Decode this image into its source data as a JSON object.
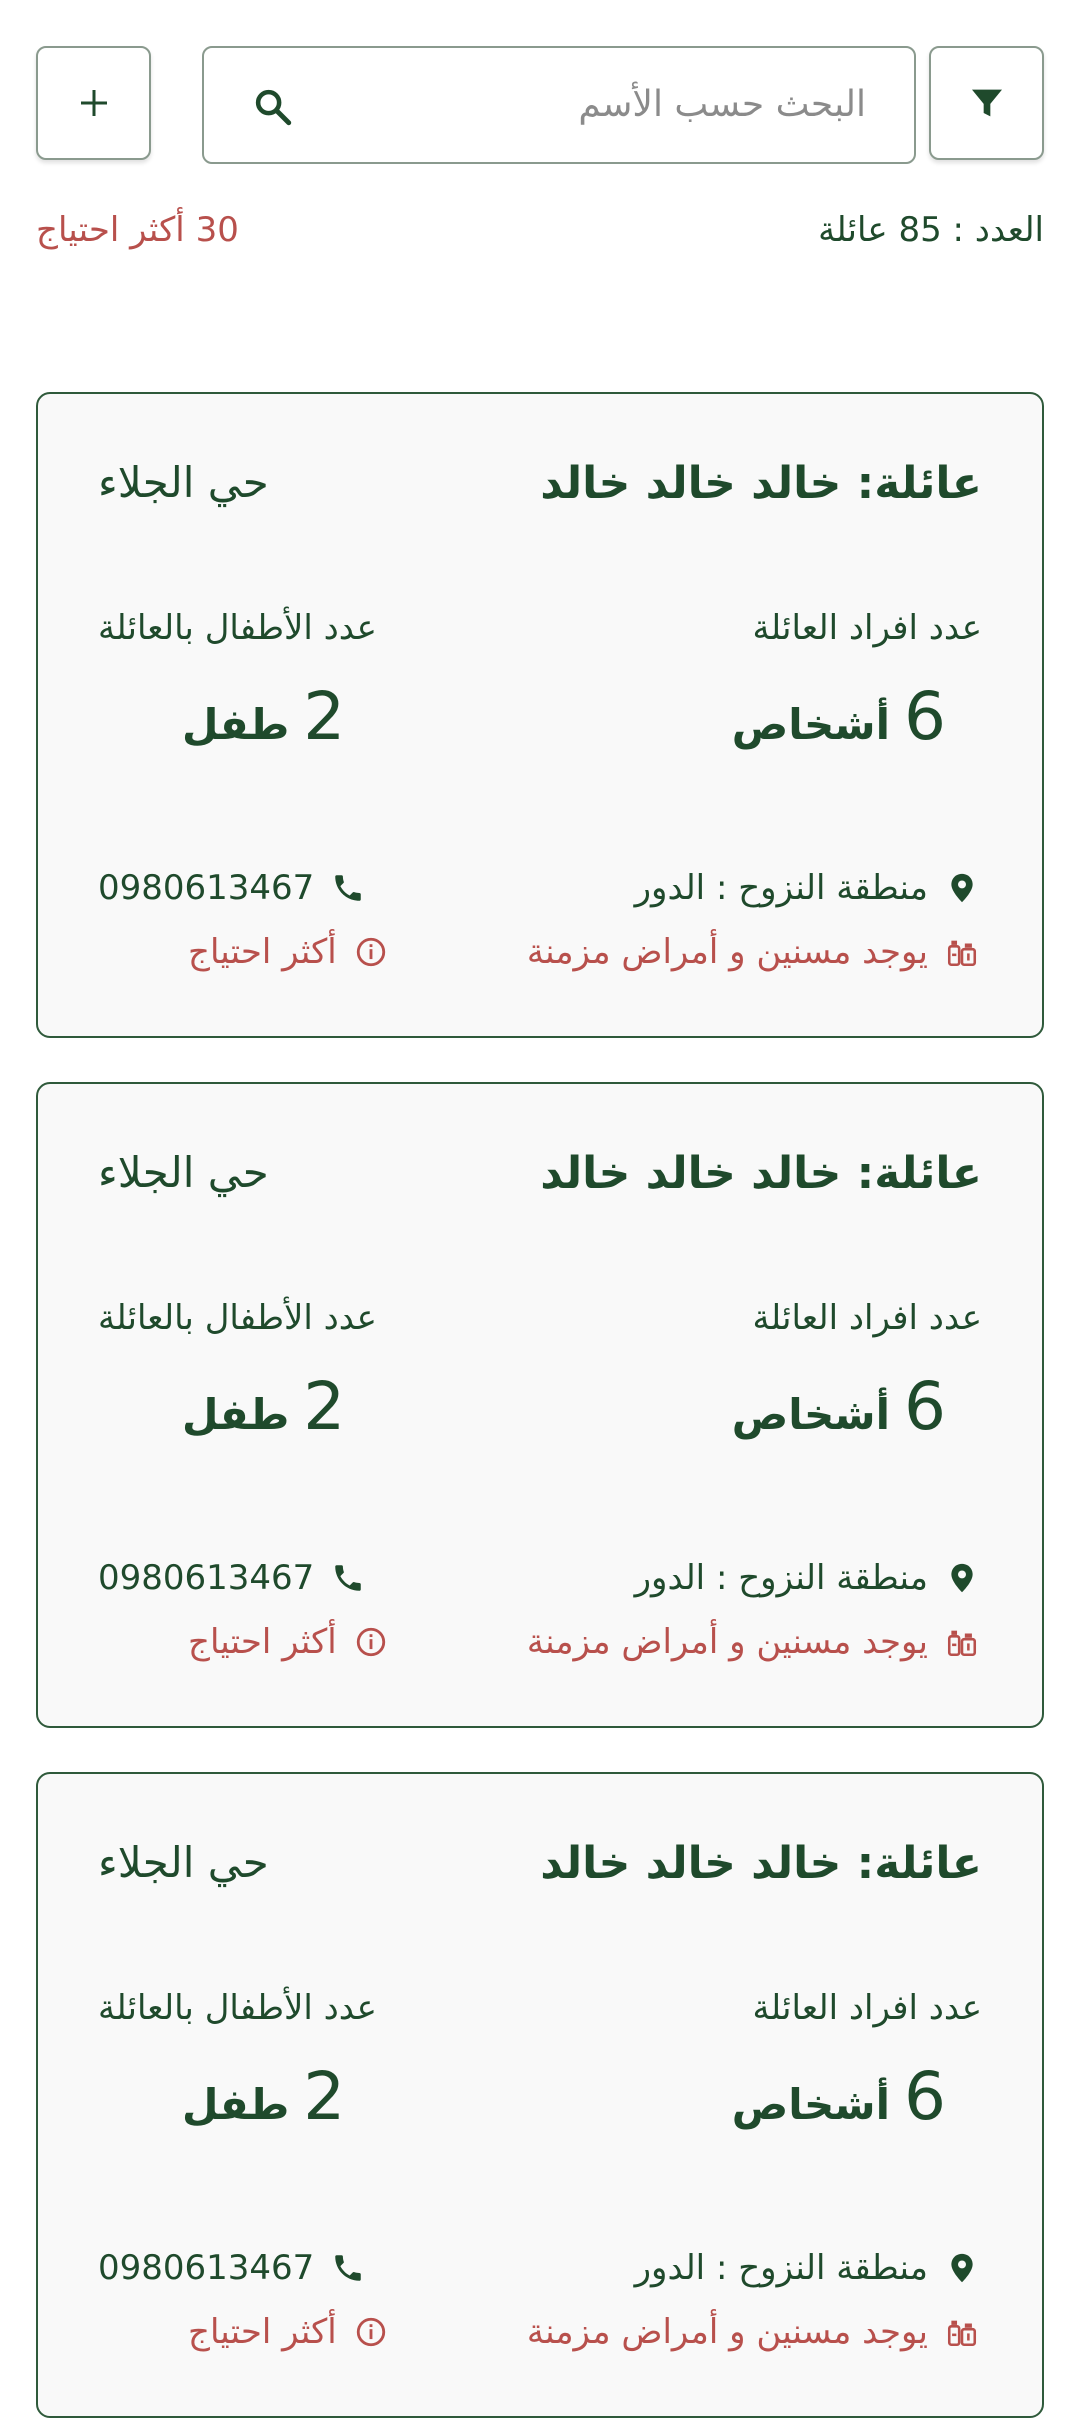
{
  "toolbar": {
    "add_icon": "plus-icon",
    "filter_icon": "filter-icon"
  },
  "search": {
    "placeholder": "البحث حسب الأسم",
    "icon": "search-icon"
  },
  "stats": {
    "count_text": "العدد : 85 عائلة",
    "need_text": "30 أكثر احتياج"
  },
  "colors": {
    "primary": "#1f4a2c",
    "alert": "#b8504c",
    "card_bg": "#f9f9f9"
  },
  "cards": [
    {
      "title": "عائلة: خالد خالد خالد",
      "district": "حي الجلاء",
      "members_label": "عدد افراد  العائلة",
      "members_value": "6",
      "members_unit": "أشخاص",
      "children_label": "عدد الأطفال بالعائلة",
      "children_value": "2",
      "children_unit": "طفل",
      "displacement": "منطقة النزوح : الدور",
      "phone": "0980613467",
      "health": "يوجد مسنين و أمراض مزمنة",
      "need": "أكثر احتياج"
    },
    {
      "title": "عائلة: خالد خالد خالد",
      "district": "حي الجلاء",
      "members_label": "عدد افراد  العائلة",
      "members_value": "6",
      "members_unit": "أشخاص",
      "children_label": "عدد الأطفال بالعائلة",
      "children_value": "2",
      "children_unit": "طفل",
      "displacement": "منطقة النزوح : الدور",
      "phone": "0980613467",
      "health": "يوجد مسنين و أمراض مزمنة",
      "need": "أكثر احتياج"
    },
    {
      "title": "عائلة: خالد خالد خالد",
      "district": "حي الجلاء",
      "members_label": "عدد افراد  العائلة",
      "members_value": "6",
      "members_unit": "أشخاص",
      "children_label": "عدد الأطفال بالعائلة",
      "children_value": "2",
      "children_unit": "طفل",
      "displacement": "منطقة النزوح : الدور",
      "phone": "0980613467",
      "health": "يوجد مسنين و أمراض مزمنة",
      "need": "أكثر احتياج"
    }
  ]
}
